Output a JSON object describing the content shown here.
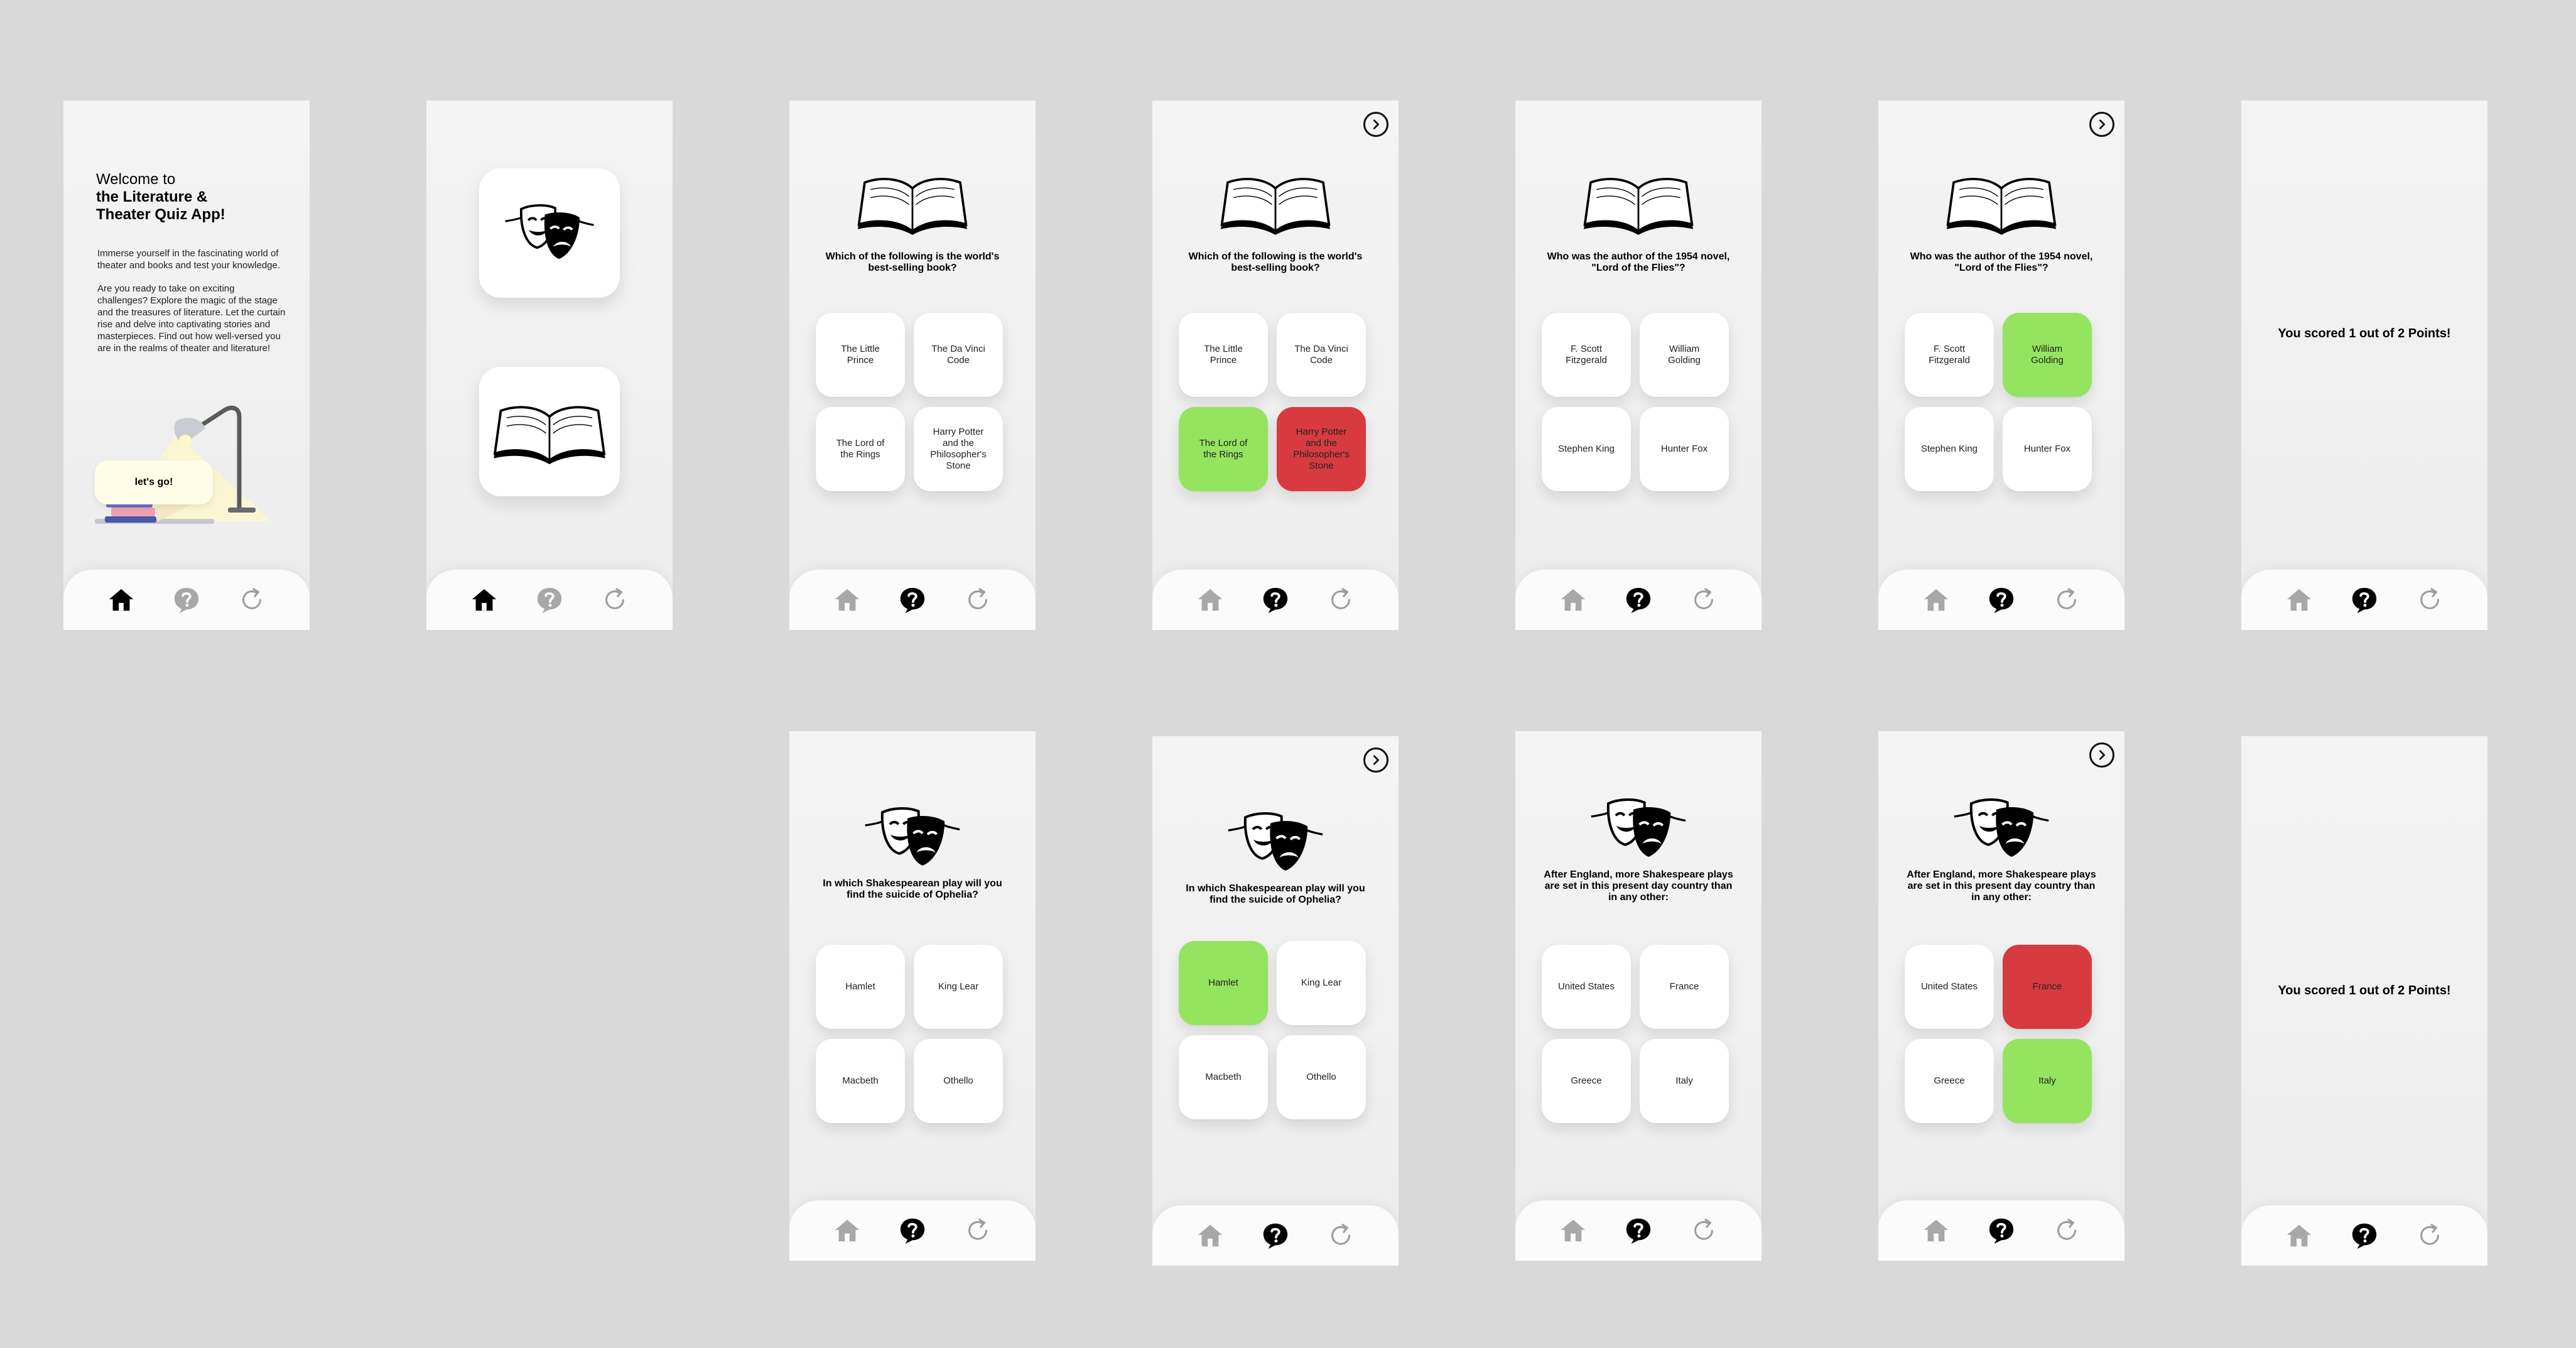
{
  "welcome": {
    "line1": "Welcome to",
    "line2": "the Literature &",
    "line3": "Theater Quiz App!",
    "para1": "Immerse yourself in the fascinating world of theater and books and test your knowledge.",
    "para2": "Are you ready to take on exciting challenges? Explore the magic of the stage and the treasures of literature. Let the curtain rise and delve into captivating stories and masterpieces. Find out how well-versed you are in the realms of theater and literature!",
    "button": "let's go!"
  },
  "questions": {
    "q1": "Which of the following is the world's best-selling book?",
    "q2": "Who was the author of the 1954 novel, \"Lord of the Flies\"?",
    "q3": "In which Shakespearean play will you find the suicide of Ophelia?",
    "q4": "After England, more Shakespeare plays are set in this present day country than in any other:"
  },
  "answers": {
    "q1": [
      "The Little Prince",
      "The Da Vinci Code",
      "The Lord of the Rings",
      "Harry Potter and the Philosopher's Stone"
    ],
    "q2": [
      "F. Scott Fitzgerald",
      "William Golding",
      "Stephen King",
      "Hunter Fox"
    ],
    "q3": [
      "Hamlet",
      "King Lear",
      "Macbeth",
      "Othello"
    ],
    "q4": [
      "United States",
      "France",
      "Greece",
      "Italy"
    ]
  },
  "score_text": "You scored 1 out of 2 Points!",
  "icons": {
    "home": "home-icon",
    "quiz": "question-bubble-icon",
    "restart": "refresh-icon",
    "next": "chevron-right-circle-icon",
    "book": "open-book-icon",
    "masks": "theater-masks-icon"
  },
  "colors": {
    "correct": "#94e45f",
    "wrong": "#d73b3f",
    "background": "#d9d9d9"
  }
}
